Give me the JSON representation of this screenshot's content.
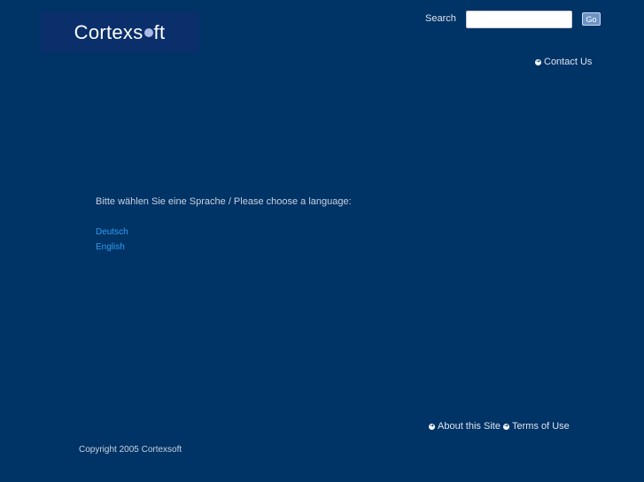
{
  "logo": {
    "text_pre": "Cortexs",
    "text_post": "ft"
  },
  "header": {
    "search_label": "Search",
    "search_value": "",
    "go_label": "Go",
    "contact_label": "Contact Us"
  },
  "main": {
    "prompt": "Bitte wählen Sie eine Sprache / Please choose a language:",
    "languages": [
      "Deutsch",
      "English"
    ]
  },
  "footer": {
    "about_label": "About this Site",
    "terms_label": "Terms of Use",
    "copyright": "Copyright 2005 Cortexsoft"
  }
}
